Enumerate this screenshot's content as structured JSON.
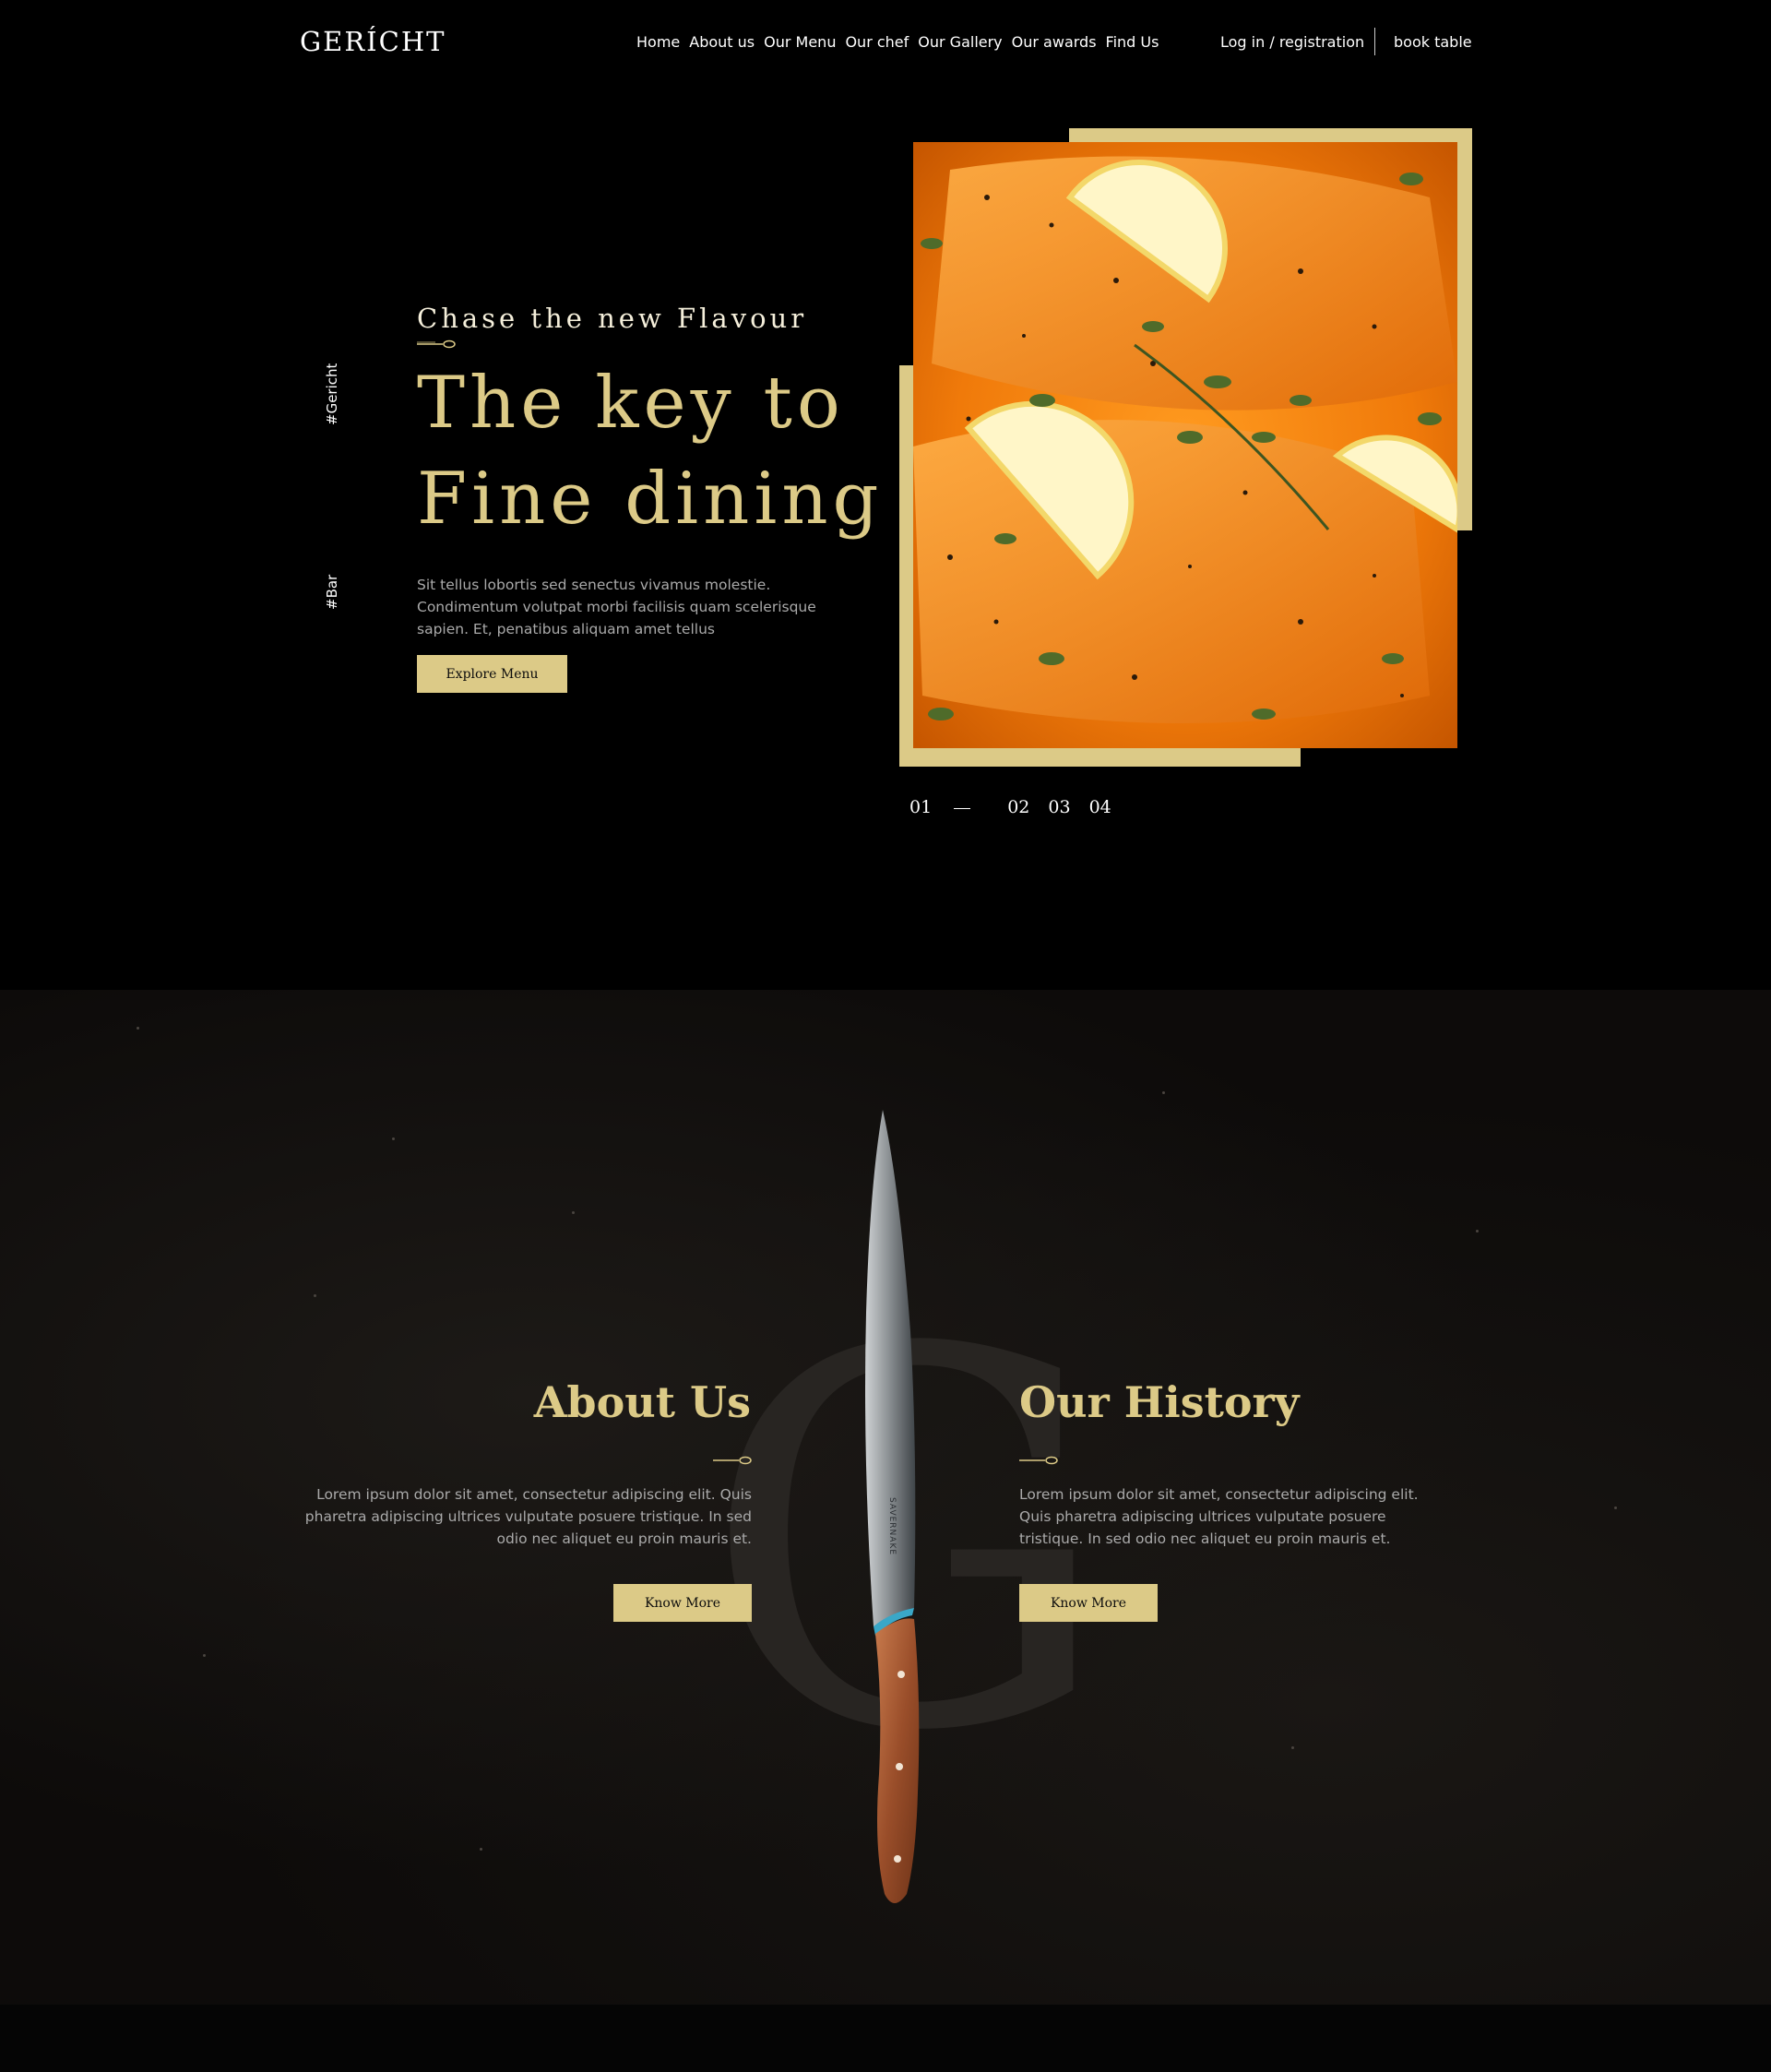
{
  "nav": {
    "logo": "GERÍCHT",
    "links": [
      "Home",
      "About us",
      "Our Menu",
      "Our chef",
      "Our Gallery",
      "Our awards",
      "Find Us"
    ],
    "login": "Log in / registration",
    "book": "book table"
  },
  "hero": {
    "tags": [
      "#Gericht",
      "#Bar"
    ],
    "subtitle": "Chase the new Flavour",
    "title_line1": "The key to",
    "title_line2": "Fine dining",
    "description": "Sit tellus lobortis sed senectus vivamus molestie. Condimentum volutpat morbi facilisis quam scelerisque sapien. Et, penatibus aliquam amet tellus",
    "button": "Explore Menu",
    "slides": [
      "01",
      "02",
      "03",
      "04"
    ],
    "active_slide": 0
  },
  "about": {
    "watermark": "G",
    "left": {
      "title": "About Us",
      "text": "Lorem ipsum dolor sit amet, consectetur adipiscing elit. Quis pharetra adipiscing ultrices vulputate posuere tristique. In sed odio nec aliquet eu proin mauris et.",
      "button": "Know More"
    },
    "right": {
      "title": "Our History",
      "text": "Lorem ipsum dolor sit amet, consectetur adipiscing elit. Quis pharetra adipiscing ultrices vulputate posuere tristique. In sed odio nec aliquet eu proin mauris et.",
      "button": "Know More"
    },
    "knife_brand": "SAVERNAKE"
  },
  "colors": {
    "gold": "#dcca87",
    "background": "#000000",
    "text_grey": "#aaaaaa",
    "cream": "#f5efdb"
  },
  "icons": [
    "spoon-icon",
    "knife-illustration",
    "food-photo"
  ]
}
